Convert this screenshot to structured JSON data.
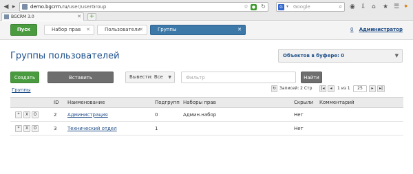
{
  "browser": {
    "url_host": "demo.bgcrm.ru",
    "url_path": "/user/userGroup",
    "search_engine_label": "G",
    "search_placeholder": "Google",
    "tab_title": "BGCRM 3.0"
  },
  "app": {
    "start_label": "Пуск",
    "tabs": [
      {
        "label": "Набор прав"
      },
      {
        "label": "Пользователи"
      },
      {
        "label": "Группы"
      }
    ],
    "buffer_count": "0",
    "user_name": "Администратор"
  },
  "page": {
    "title": "Группы пользователей",
    "buffer_label": "Объектов в буфере:",
    "buffer_value": "0",
    "create_label": "Создать",
    "paste_label": "Вставить (Администратор)",
    "output_select_value": "Вывести: Все",
    "filter_placeholder": "Фильтр",
    "find_label": "Найти",
    "breadcrumb": "Группы"
  },
  "pager": {
    "records_text": "Записей: 2  Стр",
    "page_text": "1 из 1",
    "page_size": "25"
  },
  "table": {
    "columns": [
      "ID",
      "Наименование",
      "Подгрупп",
      "Наборы прав",
      "Скрыли",
      "Комментарий"
    ],
    "rows": [
      {
        "id": "2",
        "name": "Администрация",
        "subgroups": "0",
        "permsets": "Админ.набор",
        "hidden": "Нет",
        "comment": ""
      },
      {
        "id": "3",
        "name": "Технический отдел",
        "subgroups": "1",
        "permsets": "",
        "hidden": "Нет",
        "comment": ""
      }
    ],
    "row_actions": {
      "edit": "*",
      "delete": "X",
      "open": "O"
    }
  }
}
